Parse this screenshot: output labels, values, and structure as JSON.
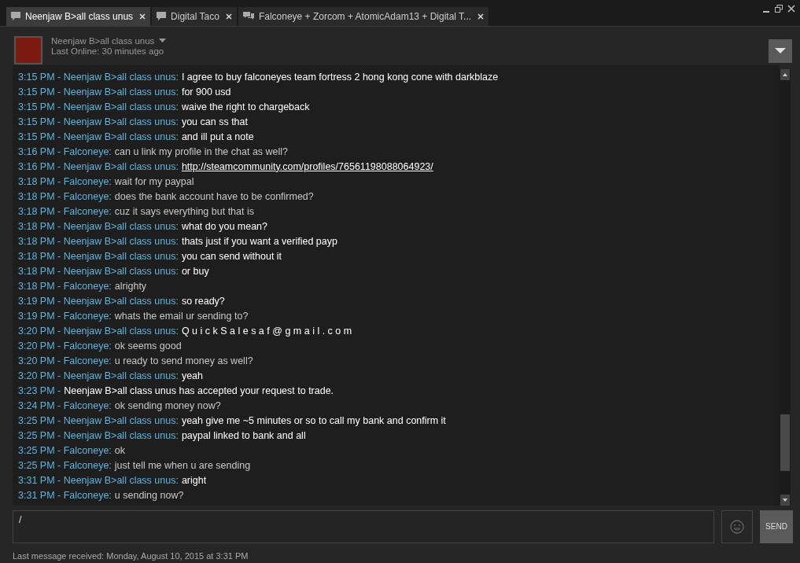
{
  "tabs": [
    {
      "label": "Neenjaw B>all class unus",
      "kind": "single",
      "selected": true
    },
    {
      "label": "Digital Taco",
      "kind": "single",
      "selected": false
    },
    {
      "label": "Falconeye + Zorcom + AtomicAdam13 + Digital T...",
      "kind": "group",
      "selected": false
    }
  ],
  "friend": {
    "name": "Neenjaw B>all class unus",
    "status": "Last Online: 30 minutes ago"
  },
  "messages": [
    {
      "kind": "message",
      "prefix": "3:15 PM - Neenjaw B>all class unus:",
      "from_friend": true,
      "text": "I agree to buy falconeyes team fortress 2 hong kong cone with darkblaze"
    },
    {
      "kind": "message",
      "prefix": "3:15 PM - Neenjaw B>all class unus:",
      "from_friend": true,
      "text": "for 900 usd"
    },
    {
      "kind": "message",
      "prefix": "3:15 PM - Neenjaw B>all class unus:",
      "from_friend": true,
      "text": "waive the right to chargeback"
    },
    {
      "kind": "message",
      "prefix": "3:15 PM - Neenjaw B>all class unus:",
      "from_friend": true,
      "text": "you can ss that"
    },
    {
      "kind": "message",
      "prefix": "3:15 PM - Neenjaw B>all class unus:",
      "from_friend": true,
      "text": "and ill put a note"
    },
    {
      "kind": "message",
      "prefix": "3:16 PM - Falconeye:",
      "from_friend": false,
      "text": "can u link my profile in the chat as well?"
    },
    {
      "kind": "link",
      "prefix": "3:16 PM - Neenjaw B>all class unus:",
      "from_friend": true,
      "text": "http://steamcommunity.com/profiles/76561198088064923/"
    },
    {
      "kind": "message",
      "prefix": "3:18 PM - Falconeye:",
      "from_friend": false,
      "text": "wait for my paypal"
    },
    {
      "kind": "message",
      "prefix": "3:18 PM - Falconeye:",
      "from_friend": false,
      "text": "does the bank account have to be confirmed?"
    },
    {
      "kind": "message",
      "prefix": "3:18 PM - Falconeye:",
      "from_friend": false,
      "text": "cuz it says everything but that is"
    },
    {
      "kind": "message",
      "prefix": "3:18 PM - Neenjaw B>all class unus:",
      "from_friend": true,
      "text": "what do you mean?"
    },
    {
      "kind": "message",
      "prefix": "3:18 PM - Neenjaw B>all class unus:",
      "from_friend": true,
      "text": "thats just if you want a verified payp"
    },
    {
      "kind": "message",
      "prefix": "3:18 PM - Neenjaw B>all class unus:",
      "from_friend": true,
      "text": "you can send without it"
    },
    {
      "kind": "message",
      "prefix": "3:18 PM - Neenjaw B>all class unus:",
      "from_friend": true,
      "text": "or buy"
    },
    {
      "kind": "message",
      "prefix": "3:18 PM - Falconeye:",
      "from_friend": false,
      "text": "alrighty"
    },
    {
      "kind": "message",
      "prefix": "3:19 PM - Neenjaw B>all class unus:",
      "from_friend": true,
      "text": "so ready?"
    },
    {
      "kind": "message",
      "prefix": "3:19 PM - Falconeye:",
      "from_friend": false,
      "text": "whats the email ur sending to?"
    },
    {
      "kind": "message",
      "prefix": "3:20 PM - Neenjaw B>all class unus:",
      "from_friend": true,
      "text": "Q u i c k S a l e s a f @ g m a i l . c o m"
    },
    {
      "kind": "message",
      "prefix": "3:20 PM - Falconeye:",
      "from_friend": false,
      "text": "ok seems good"
    },
    {
      "kind": "message",
      "prefix": "3:20 PM - Falconeye:",
      "from_friend": false,
      "text": "u ready to send money as well?"
    },
    {
      "kind": "message",
      "prefix": "3:20 PM - Neenjaw B>all class unus:",
      "from_friend": true,
      "text": "yeah"
    },
    {
      "kind": "event",
      "prefix": "3:23 PM -",
      "text": "Neenjaw B>all class unus has accepted your request to trade."
    },
    {
      "kind": "message",
      "prefix": "3:24 PM - Falconeye:",
      "from_friend": false,
      "text": "ok sending money now?"
    },
    {
      "kind": "message",
      "prefix": "3:25 PM - Neenjaw B>all class unus:",
      "from_friend": true,
      "text": "yeah give me ~5 minutes or so to call my bank and confirm it"
    },
    {
      "kind": "message",
      "prefix": "3:25 PM - Neenjaw B>all class unus:",
      "from_friend": true,
      "text": "paypal linked to bank and all"
    },
    {
      "kind": "message",
      "prefix": "3:25 PM - Falconeye:",
      "from_friend": false,
      "text": "ok"
    },
    {
      "kind": "message",
      "prefix": "3:25 PM - Falconeye:",
      "from_friend": false,
      "text": "just tell me when u are sending"
    },
    {
      "kind": "message",
      "prefix": "3:31 PM - Neenjaw B>all class unus:",
      "from_friend": true,
      "text": "aright"
    },
    {
      "kind": "message",
      "prefix": "3:31 PM - Falconeye:",
      "from_friend": false,
      "text": "u sending now?"
    }
  ],
  "input": {
    "value": "/"
  },
  "send_button": "SEND",
  "status_bar": "Last message received: Monday, August 10, 2015 at 3:31 PM"
}
